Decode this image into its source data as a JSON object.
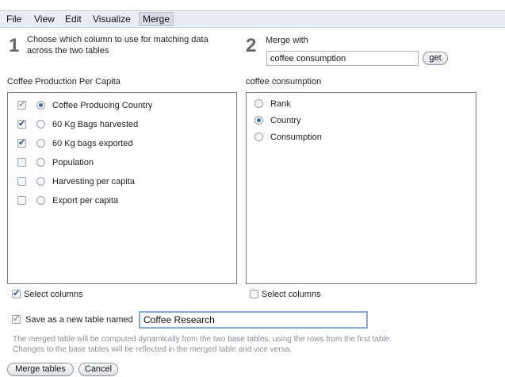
{
  "menu": {
    "items": [
      "File",
      "View",
      "Edit",
      "Visualize",
      "Merge"
    ]
  },
  "step1": {
    "number": "1",
    "text_line1": "Choose which column to use for matching data",
    "text_line2": "across the two tables"
  },
  "step2": {
    "number": "2",
    "text": "Merge with",
    "input_value": "coffee consumption",
    "get_label": "get"
  },
  "left_panel": {
    "title": "Coffee Production Per Capita",
    "rows": [
      {
        "label": "Coffee Producing Country",
        "checked": true,
        "checkbox_disabled": true,
        "radio_selected": true
      },
      {
        "label": "60 Kg Bags harvested",
        "checked": true,
        "checkbox_disabled": false,
        "radio_selected": false
      },
      {
        "label": "60 Kg bags exported",
        "checked": true,
        "checkbox_disabled": false,
        "radio_selected": false
      },
      {
        "label": "Population",
        "checked": false,
        "checkbox_disabled": false,
        "radio_selected": false
      },
      {
        "label": "Harvesting per capita",
        "checked": false,
        "checkbox_disabled": false,
        "radio_selected": false
      },
      {
        "label": "Export per capita",
        "checked": false,
        "checkbox_disabled": false,
        "radio_selected": false
      }
    ],
    "select_columns_label": "Select columns",
    "select_columns_checked": true
  },
  "right_panel": {
    "title": "coffee consumption",
    "rows": [
      {
        "label": "Rank",
        "radio_selected": false
      },
      {
        "label": "Country",
        "radio_selected": true
      },
      {
        "label": "Consumption",
        "radio_selected": false
      }
    ],
    "select_columns_label": "Select columns",
    "select_columns_checked": false
  },
  "save": {
    "label": "Save as a new table named",
    "checked": true,
    "table_name": "Coffee Research"
  },
  "note": {
    "line1": "The merged table will be computed dynamically from the two base tables, using the rows from the first table.",
    "line2": "Changes to the base tables will be reflected in the merged table and vice versa."
  },
  "buttons": {
    "merge": "Merge tables",
    "cancel": "Cancel"
  }
}
